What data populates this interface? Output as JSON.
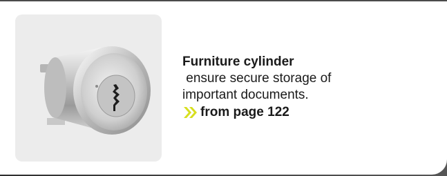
{
  "card": {
    "title": "Furniture cylinder",
    "description_line1": " ensure secure storage of",
    "description_line2": "important documents.",
    "link_label": "from page 122"
  },
  "image": {
    "icon": "furniture-cylinder-lock-image"
  },
  "colors": {
    "accent": "#d7df1f",
    "image_background": "#ececec",
    "text": "#1a1a1a"
  }
}
